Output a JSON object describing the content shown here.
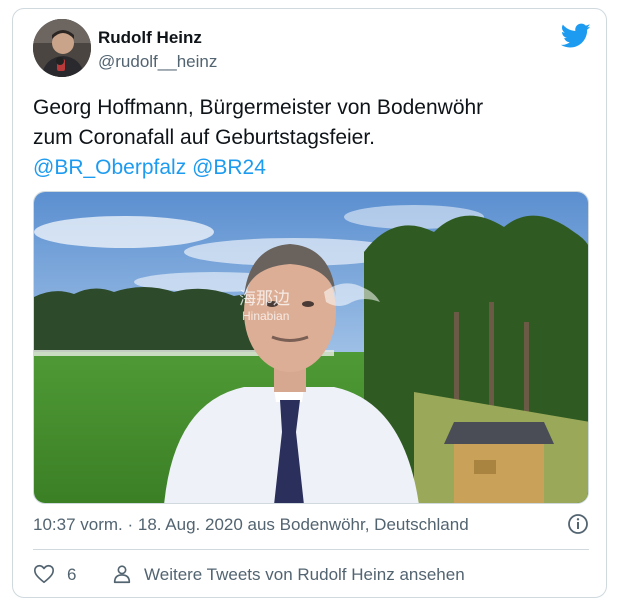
{
  "author": {
    "name": "Rudolf Heinz",
    "handle": "@rudolf__heinz"
  },
  "tweet": {
    "line1": "Georg Hoffmann, Bürgermeister von Bodenwöhr",
    "line2": "zum Coronafall auf Geburtstagsfeier.",
    "mention1": "@BR_Oberpfalz",
    "mention2": "@BR24"
  },
  "media": {
    "watermark_cn": "海那边",
    "watermark_en": "Hinabian"
  },
  "meta": {
    "timestamp": "10:37 vorm. · 18. Aug. 2020 aus Bodenwöhr, Deutschland"
  },
  "actions": {
    "like_count": "6",
    "more_tweets": "Weitere Tweets von Rudolf Heinz ansehen"
  },
  "colors": {
    "accent": "#1d9bf0",
    "secondary_text": "#536471",
    "border": "#cfd9de"
  },
  "icons": [
    "twitter-bird-icon",
    "info-icon",
    "heart-icon",
    "person-icon"
  ]
}
